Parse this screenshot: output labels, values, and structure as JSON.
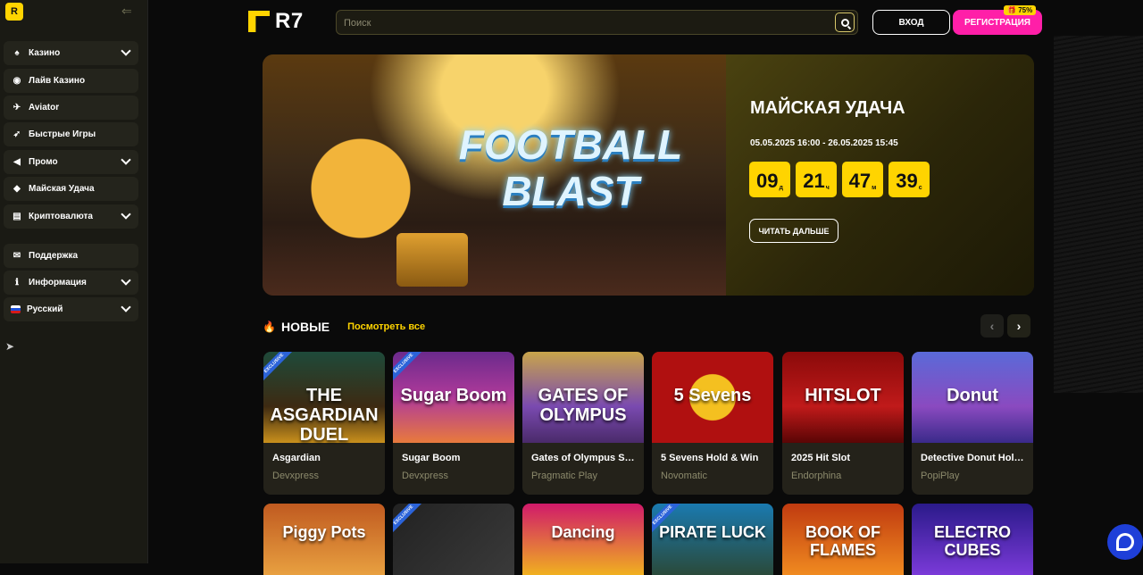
{
  "sidebar": {
    "logo": "R",
    "items": [
      {
        "label": "Казино",
        "icon": "casino-icon",
        "glyph": "♠",
        "chevron": true
      },
      {
        "label": "Лайв Казино",
        "icon": "live-casino-icon",
        "glyph": "◉",
        "chevron": false
      },
      {
        "label": "Aviator",
        "icon": "plane-icon",
        "glyph": "✈",
        "chevron": false
      },
      {
        "label": "Быстрые Игры",
        "icon": "rocket-icon",
        "glyph": "➶",
        "chevron": false
      },
      {
        "label": "Промо",
        "icon": "megaphone-icon",
        "glyph": "◀",
        "chevron": true
      },
      {
        "label": "Майская Удача",
        "icon": "ticket-icon",
        "glyph": "◆",
        "chevron": false
      },
      {
        "label": "Криптовалюта",
        "icon": "crypto-icon",
        "glyph": "▤",
        "chevron": true
      },
      {
        "label": "Поддержка",
        "icon": "support-icon",
        "glyph": "✉",
        "chevron": false
      },
      {
        "label": "Информация",
        "icon": "info-icon",
        "glyph": "ℹ",
        "chevron": true
      }
    ],
    "language": "Русский"
  },
  "header": {
    "brand": "R7",
    "search_placeholder": "Поиск",
    "login_label": "ВХОД",
    "register_label": "РЕГИСТРАЦИЯ",
    "register_badge": "75%"
  },
  "banner": {
    "art_title_line1": "FOOTBALL",
    "art_title_line2": "BLAST",
    "title": "МАЙСКАЯ УДАЧА",
    "dates": "05.05.2025 16:00 - 26.05.2025 15:45",
    "timer": [
      {
        "value": "09",
        "unit": "д"
      },
      {
        "value": "21",
        "unit": "ч"
      },
      {
        "value": "47",
        "unit": "м"
      },
      {
        "value": "39",
        "unit": "с"
      }
    ],
    "read_more": "ЧИТАТЬ ДАЛЬШЕ"
  },
  "section": {
    "title": "НОВЫЕ",
    "see_all": "Посмотреть все"
  },
  "games": [
    {
      "name": "Asgardian",
      "provider": "Devxpress",
      "art": "THE ASGARDIAN DUEL",
      "exclusive": true,
      "bg": "linear-gradient(180deg,#1e4a3a,#3d2a12 60%,#c9901c)"
    },
    {
      "name": "Sugar Boom",
      "provider": "Devxpress",
      "art": "Sugar Boom",
      "exclusive": true,
      "bg": "linear-gradient(180deg,#6b2a8c,#b03a9a 50%,#e87a3c)"
    },
    {
      "name": "Gates of Olympus Super Scatter",
      "provider": "Pragmatic Play",
      "art": "GATES OF OLYMPUS",
      "exclusive": false,
      "bg": "linear-gradient(180deg,#c9a54a,#7a4ab0 60%,#4a2a6a)"
    },
    {
      "name": "5 Sevens Hold & Win",
      "provider": "Novomatic",
      "art": "5 Sevens",
      "exclusive": false,
      "bg": "radial-gradient(circle at 50% 50%,#f4c020 0 30%,#b01010 31% 100%)"
    },
    {
      "name": "2025 Hit Slot",
      "provider": "Endorphina",
      "art": "HITSLOT",
      "exclusive": false,
      "bg": "linear-gradient(180deg,#8a0a0a,#c01a1a 60%,#5a0505)"
    },
    {
      "name": "Detective Donut Hold & Win",
      "provider": "PopiPlay",
      "art": "Donut",
      "exclusive": false,
      "bg": "linear-gradient(180deg,#5a6ad8,#8a4ac0 60%,#3a2a8a)"
    }
  ],
  "games_row2": [
    {
      "art": "Piggy Pots",
      "exclusive": false,
      "bg": "linear-gradient(180deg,#c05a20,#e8a040)"
    },
    {
      "art": "",
      "exclusive": true,
      "bg": "linear-gradient(135deg,#222,#3a3a3a)"
    },
    {
      "art": "Dancing",
      "exclusive": false,
      "bg": "linear-gradient(180deg,#d01a6a,#f0b020)"
    },
    {
      "art": "PIRATE LUCK",
      "exclusive": true,
      "bg": "linear-gradient(180deg,#1a7ab0,#2a4a3a)"
    },
    {
      "art": "BOOK OF FLAMES",
      "exclusive": false,
      "bg": "linear-gradient(180deg,#c03a10,#f08a20)"
    },
    {
      "art": "ELECTRO CUBES",
      "exclusive": false,
      "bg": "linear-gradient(180deg,#2a1a8a,#7a3ad8)"
    }
  ]
}
